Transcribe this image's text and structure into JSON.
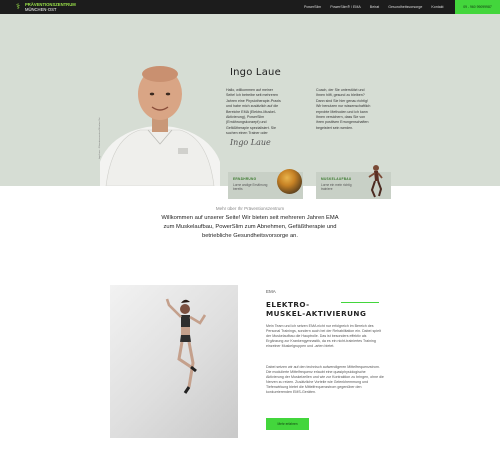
{
  "nav": {
    "logo_line1": "PRÄVENTIONSZENTRUM",
    "logo_line2_a": "MÜNCHEN",
    "logo_line2_dash": "-",
    "logo_line2_b": "OST",
    "menu": [
      "PowerSlim",
      "PowerSlim® / EMA",
      "Beirat",
      "Gesundheitsvorsorge",
      "Kontakt"
    ],
    "cta_label": "09 - 960 99099987"
  },
  "hero": {
    "name": "Ingo Laue",
    "col1_text": "Hallo, willkommen auf meiner Seite! Ich betreibe seit mehreren Jahren eine Physiotherapie-Praxis und habe mich zusätzlich auf die Bereiche EMA (Elektro-Muskel-Aktivierung), PowerSlim (Ernährungskonzept) und Gefäßtherapie spezialisiert. Sie suchen einen Trainer oder",
    "col2_text": "Coach, der Sie unterstützt und Ihnen hilft, gesund zu bleiben? Dann sind Sie hier genau richtig! Wir benutzen nur wissenschaftlich erprobte Methoden und ich kann Ihnen versichern, dass Sie von ihren positiven Errungenschaften begeistert sein werden.",
    "signature": "Ingo Laue",
    "side_caption": "Ingo Laue – Präventionszentrum München Ost",
    "cards": [
      {
        "title": "ERNÄHRUNG",
        "subtitle": "Lorne andige Ernährung bereits"
      },
      {
        "title": "MUSKELAUFBAU",
        "subtitle": "Lorne ein mein richtig trainiere"
      }
    ]
  },
  "intro": {
    "subtitle": "Mehr über Ihr Präventionszentrum",
    "text": "Willkommen auf unserer Seite! Wir bieten seit mehreren Jahren EMA zum Muskelaufbau, PowerSlim zum Abnehmen, Gefäßtherapie und betriebliche Gesundheitsvorsorge an."
  },
  "ema": {
    "tag": "EMA",
    "title_line1": "ELEKTRO-",
    "title_line2": "MUSKEL-AKTIVIERUNG",
    "p1": "Mein Team und ich setzen EMA nicht nur erfolgreich im Bereich des Personal Trainings, sondern auch bei der Rehabilitation ein. Dabei spielt der Muskelaufbau die Hauptrolle. Das ist besonders effektiv als Ergänzung zur Krankengymnastik, da es ein nicht-trainiertes Training einzelner Muskelgruppen und -arten bietet.",
    "p2": "Dabei setzen wir auf den technisch aufwendigeren Mittelfrequenzstrom. Die modulierte Mittelfrequenz erlaubt eine quasiphysiologische Aktivierung der Muskelzellen und wie zur Kontraktion zu bringen, ohne die Nerven zu reizen. Zusätzliche Vorteile wie Gelenkhemmung und Tiefenwirkung bietet die Mittelfrequenzstrom gegenüber den konkurrierenden EMS-Geräten.",
    "button_label": "Mehr erfahren"
  },
  "colors": {
    "accent": "#43d63c",
    "nav_bg": "#1c1c1c",
    "hero_bg": "#d6ddd4",
    "card_bg": "#c8d0c6"
  }
}
